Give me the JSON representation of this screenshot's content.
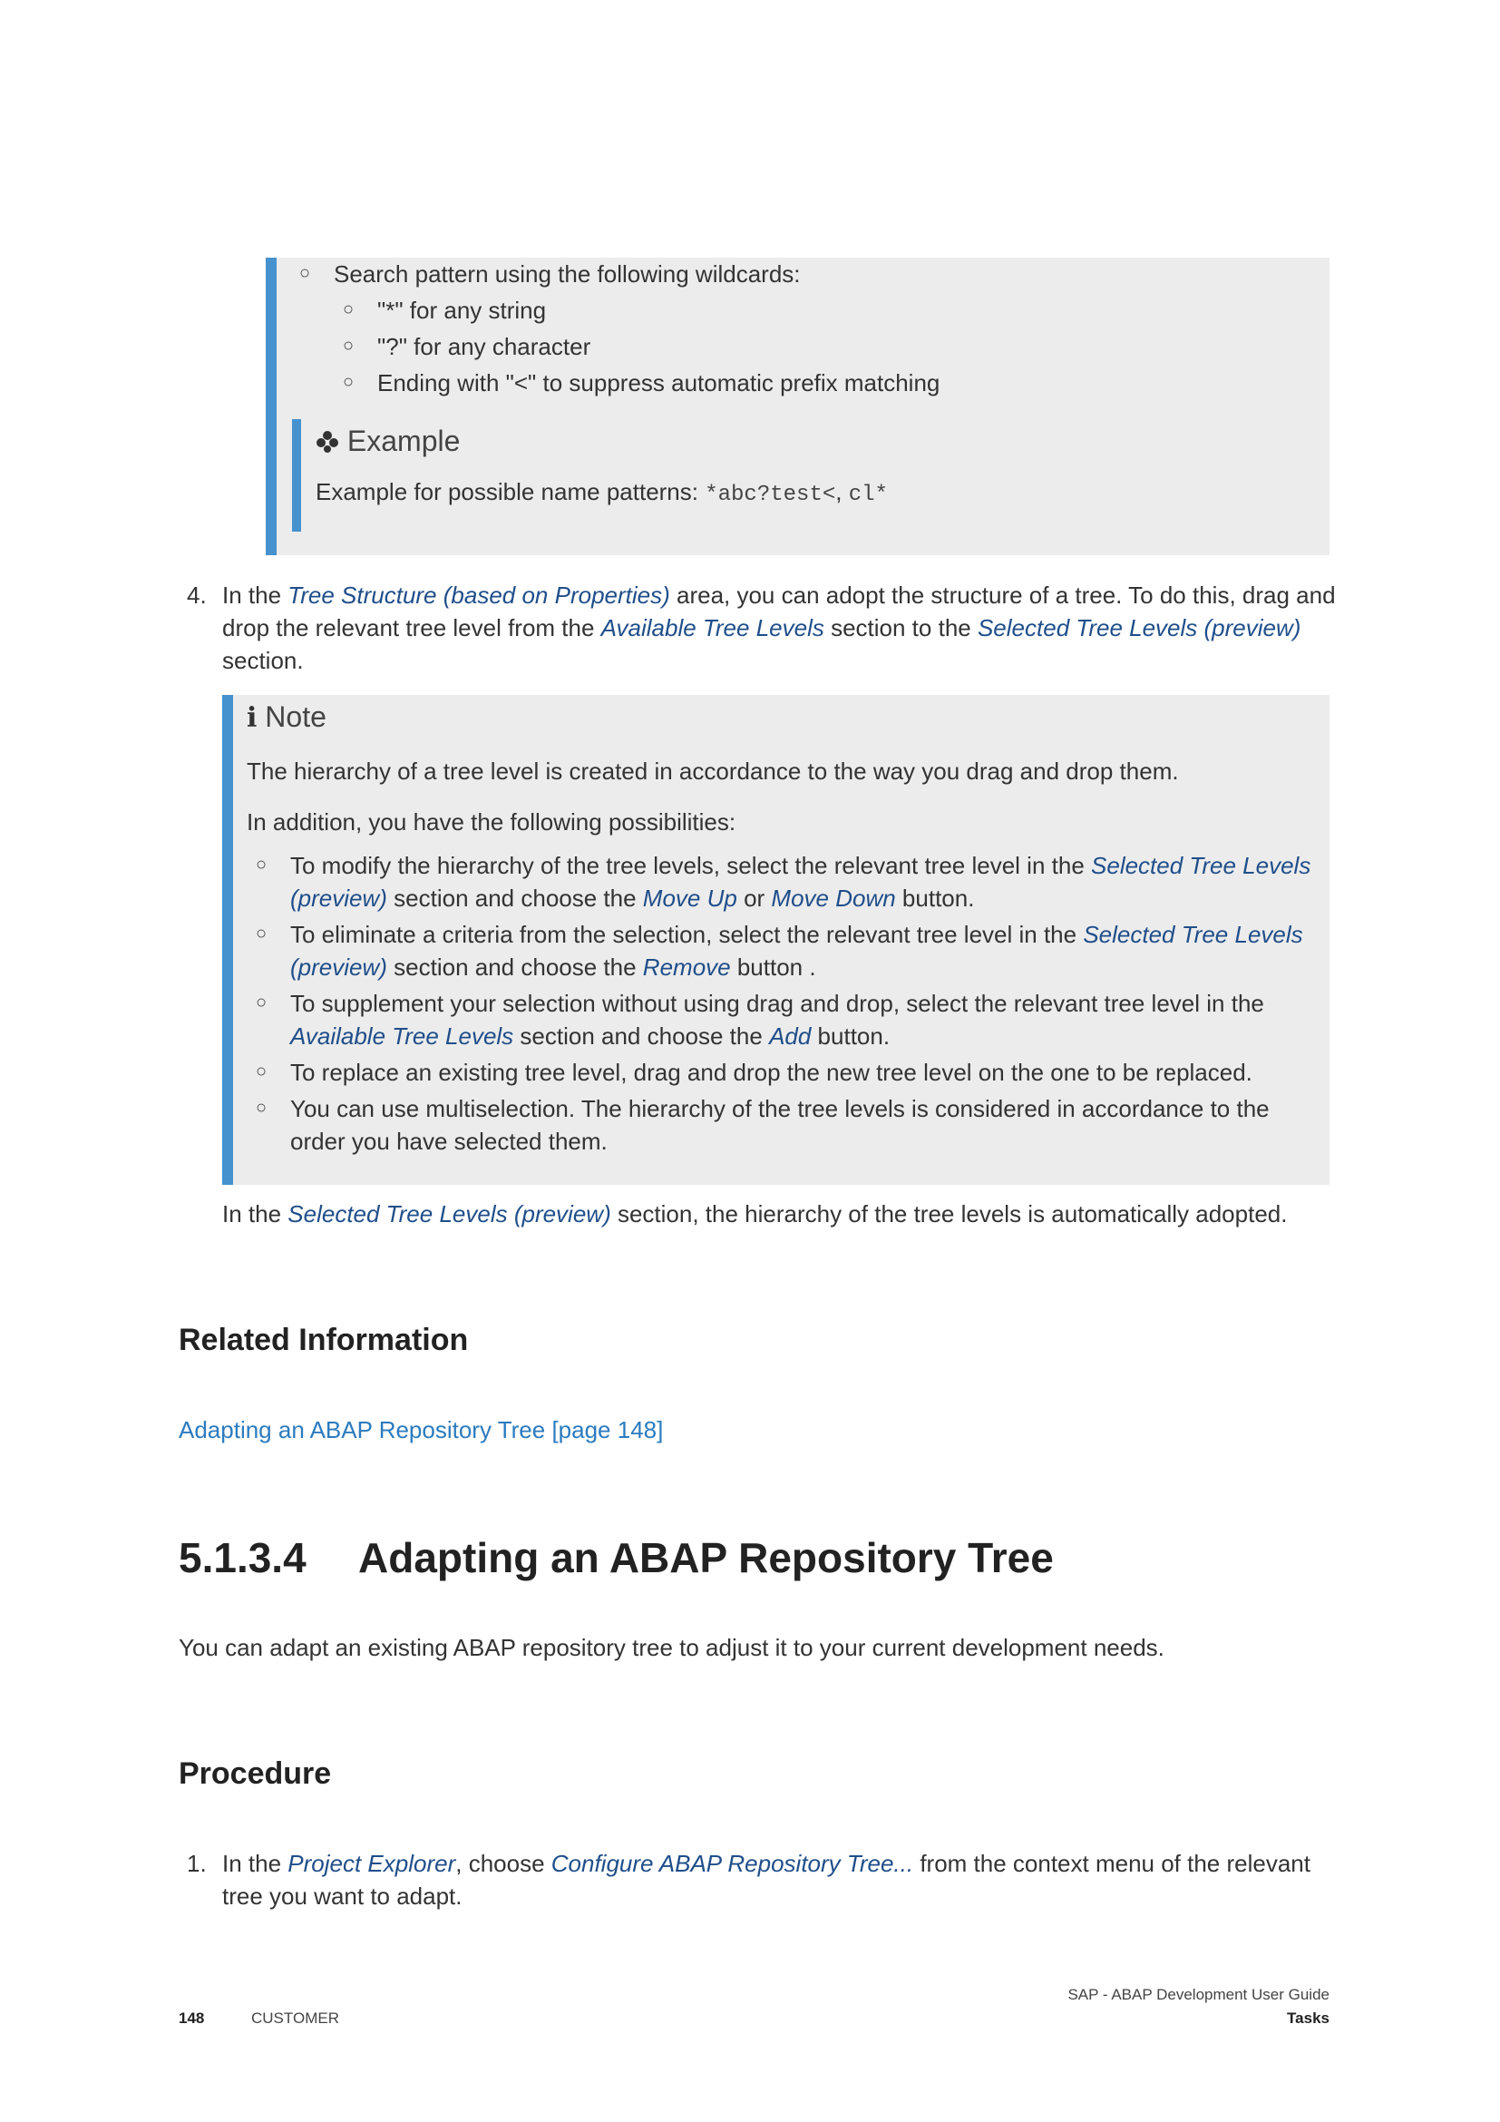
{
  "wildcards": {
    "intro": "Search pattern using the following wildcards:",
    "items": [
      "\"*\" for any string",
      "\"?\" for any character",
      "Ending with \"<\" to suppress automatic prefix matching"
    ],
    "example": {
      "title": "Example",
      "text": "Example for possible name patterns: ",
      "code1": "*abc?test<",
      "sep": ", ",
      "code2": "cl*"
    }
  },
  "step4": {
    "number": "4.",
    "p1": "In the ",
    "t1": "Tree Structure (based on Properties)",
    "p2": " area, you can adopt the structure of a tree. To do this, drag and",
    "p3": "drop the relevant tree level from the ",
    "t2": "Available Tree Levels",
    "p4": " section to the ",
    "t3": "Selected Tree Levels (preview)",
    "p5": "section."
  },
  "note": {
    "title": "Note",
    "line1": "The hierarchy of a tree level is created in accordance to the way you drag and drop them.",
    "line2": "In addition, you have the following possibilities:",
    "b1a": "To modify the hierarchy of the tree levels, select the relevant tree level in the ",
    "b1t1": "Selected Tree Levels",
    "b1t2": "(preview)",
    "b1b": " section and choose the ",
    "b1t3": "Move Up",
    "b1c": " or ",
    "b1t4": "Move Down",
    "b1d": " button.",
    "b2a": "To eliminate a criteria from the selection, select the relevant tree level in the ",
    "b2t1": "Selected Tree Levels",
    "b2t2": "(preview)",
    "b2b": " section and choose the ",
    "b2t3": "Remove",
    "b2c": " button .",
    "b3a": "To supplement your selection without using drag and drop, select the relevant tree level in the",
    "b3t1": "Available Tree Levels",
    "b3b": " section and choose the ",
    "b3t2": "Add",
    "b3c": " button.",
    "b4": "To replace an existing tree level, drag and drop the new tree level on the one to be replaced.",
    "b5a": "You can use multiselection. The hierarchy of the tree levels is considered in accordance to the",
    "b5b": "order you have selected them."
  },
  "after_note": {
    "a": "In the ",
    "t": "Selected Tree Levels (preview)",
    "b": " section, the hierarchy of the tree levels is automatically adopted."
  },
  "related": {
    "heading": "Related Information",
    "link": "Adapting an ABAP Repository Tree [page 148]"
  },
  "section": {
    "number": "5.1.3.4",
    "title": "Adapting an ABAP Repository Tree",
    "intro": "You can adapt an existing ABAP repository tree to adjust it to your current development needs."
  },
  "procedure": {
    "heading": "Procedure",
    "number": "1.",
    "a": "In the ",
    "t1": "Project Explorer",
    "b": ", choose ",
    "t2": "Configure ABAP Repository Tree...",
    "c": " from the context menu of the relevant",
    "d": "tree you want to adapt."
  },
  "footer": {
    "page": "148",
    "label": "CUSTOMER",
    "guide": "SAP - ABAP Development User Guide",
    "section": "Tasks"
  }
}
